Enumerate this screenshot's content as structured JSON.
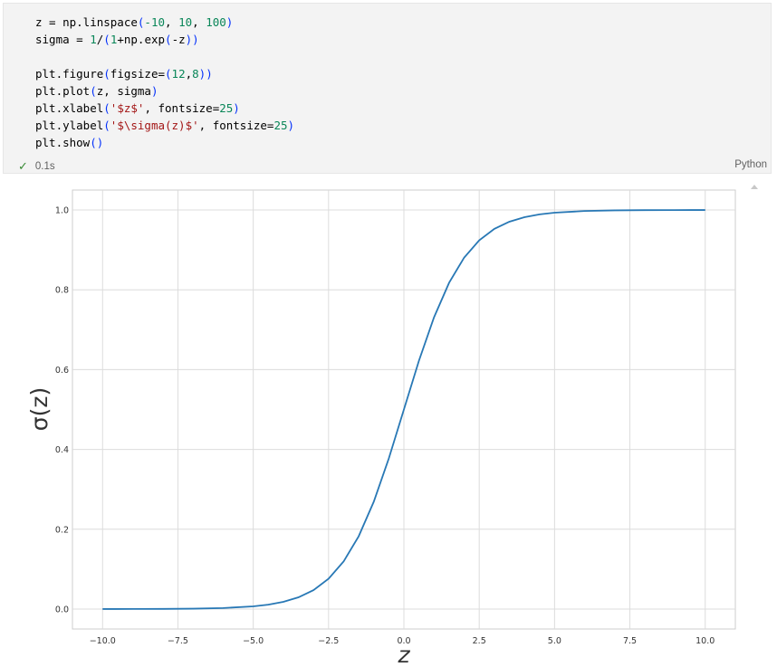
{
  "code_cell": {
    "lines": [
      [
        {
          "t": "z = np.linspace"
        },
        {
          "t": "(",
          "c": "paren"
        },
        {
          "t": "-10",
          "c": "num"
        },
        {
          "t": ", "
        },
        {
          "t": "10",
          "c": "num"
        },
        {
          "t": ", "
        },
        {
          "t": "100",
          "c": "num"
        },
        {
          "t": ")",
          "c": "paren"
        }
      ],
      [
        {
          "t": "sigma = "
        },
        {
          "t": "1",
          "c": "num"
        },
        {
          "t": "/"
        },
        {
          "t": "(",
          "c": "paren"
        },
        {
          "t": "1",
          "c": "num"
        },
        {
          "t": "+np.exp"
        },
        {
          "t": "(",
          "c": "paren"
        },
        {
          "t": "-z"
        },
        {
          "t": "))",
          "c": "paren"
        }
      ],
      [],
      [
        {
          "t": "plt.figure"
        },
        {
          "t": "(",
          "c": "paren"
        },
        {
          "t": "figsize="
        },
        {
          "t": "(",
          "c": "paren"
        },
        {
          "t": "12",
          "c": "num"
        },
        {
          "t": ","
        },
        {
          "t": "8",
          "c": "num"
        },
        {
          "t": "))",
          "c": "paren"
        }
      ],
      [
        {
          "t": "plt.plot"
        },
        {
          "t": "(",
          "c": "paren"
        },
        {
          "t": "z, sigma"
        },
        {
          "t": ")",
          "c": "paren"
        }
      ],
      [
        {
          "t": "plt.xlabel"
        },
        {
          "t": "(",
          "c": "paren"
        },
        {
          "t": "'$z$'",
          "c": "str"
        },
        {
          "t": ", fontsize="
        },
        {
          "t": "25",
          "c": "num"
        },
        {
          "t": ")",
          "c": "paren"
        }
      ],
      [
        {
          "t": "plt.ylabel"
        },
        {
          "t": "(",
          "c": "paren"
        },
        {
          "t": "'$\\sigma(z)$'",
          "c": "str"
        },
        {
          "t": ", fontsize="
        },
        {
          "t": "25",
          "c": "num"
        },
        {
          "t": ")",
          "c": "paren"
        }
      ],
      [
        {
          "t": "plt.show"
        },
        {
          "t": "()",
          "c": "paren"
        }
      ]
    ],
    "status_time": "0.1s",
    "language": "Python",
    "colors": {
      "number": "#098658",
      "string": "#a31515",
      "paren": "#0431fa",
      "check": "#388a34"
    }
  },
  "chart_data": {
    "type": "line",
    "title": "",
    "xlabel": "z",
    "ylabel": "σ(z)",
    "xlim": [
      -11,
      11
    ],
    "ylim": [
      -0.05,
      1.05
    ],
    "xticks": [
      -10.0,
      -7.5,
      -5.0,
      -2.5,
      0.0,
      2.5,
      5.0,
      7.5,
      10.0
    ],
    "xtick_labels": [
      "−10.0",
      "−7.5",
      "−5.0",
      "−2.5",
      "0.0",
      "2.5",
      "5.0",
      "7.5",
      "10.0"
    ],
    "yticks": [
      0.0,
      0.2,
      0.4,
      0.6,
      0.8,
      1.0
    ],
    "ytick_labels": [
      "0.0",
      "0.2",
      "0.4",
      "0.6",
      "0.8",
      "1.0"
    ],
    "grid": true,
    "series": [
      {
        "color": "#2878b5",
        "x": [
          -10,
          -9,
          -8,
          -7,
          -6,
          -5,
          -4.5,
          -4,
          -3.5,
          -3,
          -2.5,
          -2,
          -1.5,
          -1,
          -0.5,
          0,
          0.5,
          1,
          1.5,
          2,
          2.5,
          3,
          3.5,
          4,
          4.5,
          5,
          6,
          7,
          8,
          9,
          10
        ],
        "y": [
          4.54e-05,
          0.000123,
          0.000335,
          0.000911,
          0.00247,
          0.00669,
          0.011,
          0.018,
          0.0293,
          0.0474,
          0.0759,
          0.1192,
          0.1824,
          0.2689,
          0.3775,
          0.5,
          0.6225,
          0.7311,
          0.8176,
          0.8808,
          0.9241,
          0.9526,
          0.9707,
          0.982,
          0.989,
          0.9933,
          0.99753,
          0.99909,
          0.99966,
          0.99988,
          0.99995
        ]
      }
    ]
  }
}
